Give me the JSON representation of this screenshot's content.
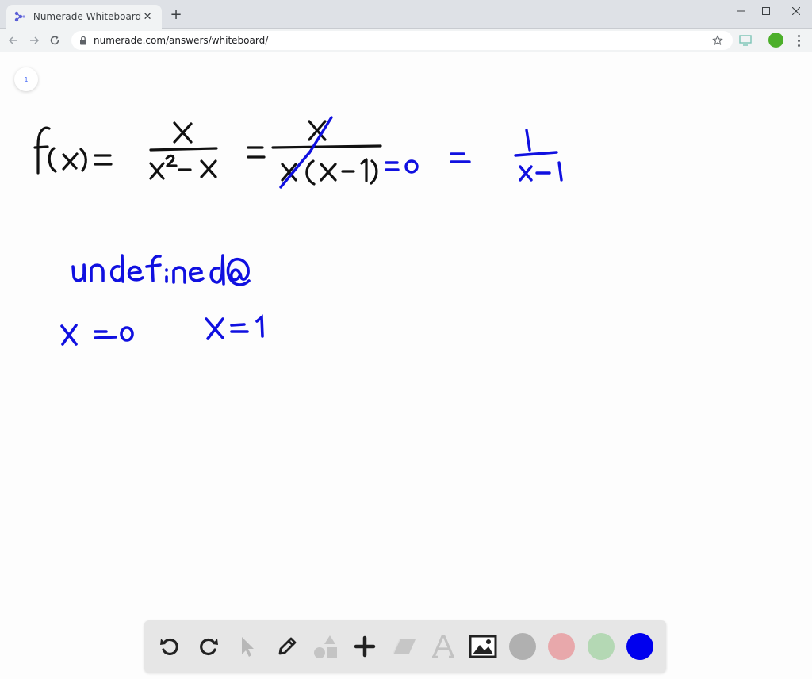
{
  "browser": {
    "tab_title": "Numerade Whiteboard",
    "tab_close": "✕",
    "new_tab": "+",
    "url": "numerade.com/answers/whiteboard/",
    "profile_initial": "I"
  },
  "whiteboard": {
    "page_number": "1",
    "ink_color": "#1010e0",
    "black_ink_color": "#111111",
    "strokes": {
      "line1": "f(x) = x / (x² − x) = x / x(x − 1) = 0 = 1 / (x − 1)",
      "line2": "undefined @",
      "line3": "x = 0    x = 1"
    }
  },
  "draw_toolbar": {
    "tools": [
      "undo-icon",
      "redo-icon",
      "pointer-icon",
      "pen-icon",
      "shapes-icon",
      "add-icon",
      "eraser-icon",
      "text-icon",
      "image-icon"
    ],
    "colors": [
      "#b0b0b0",
      "#e8a8ab",
      "#b4d8b4",
      "#0000ee"
    ]
  }
}
